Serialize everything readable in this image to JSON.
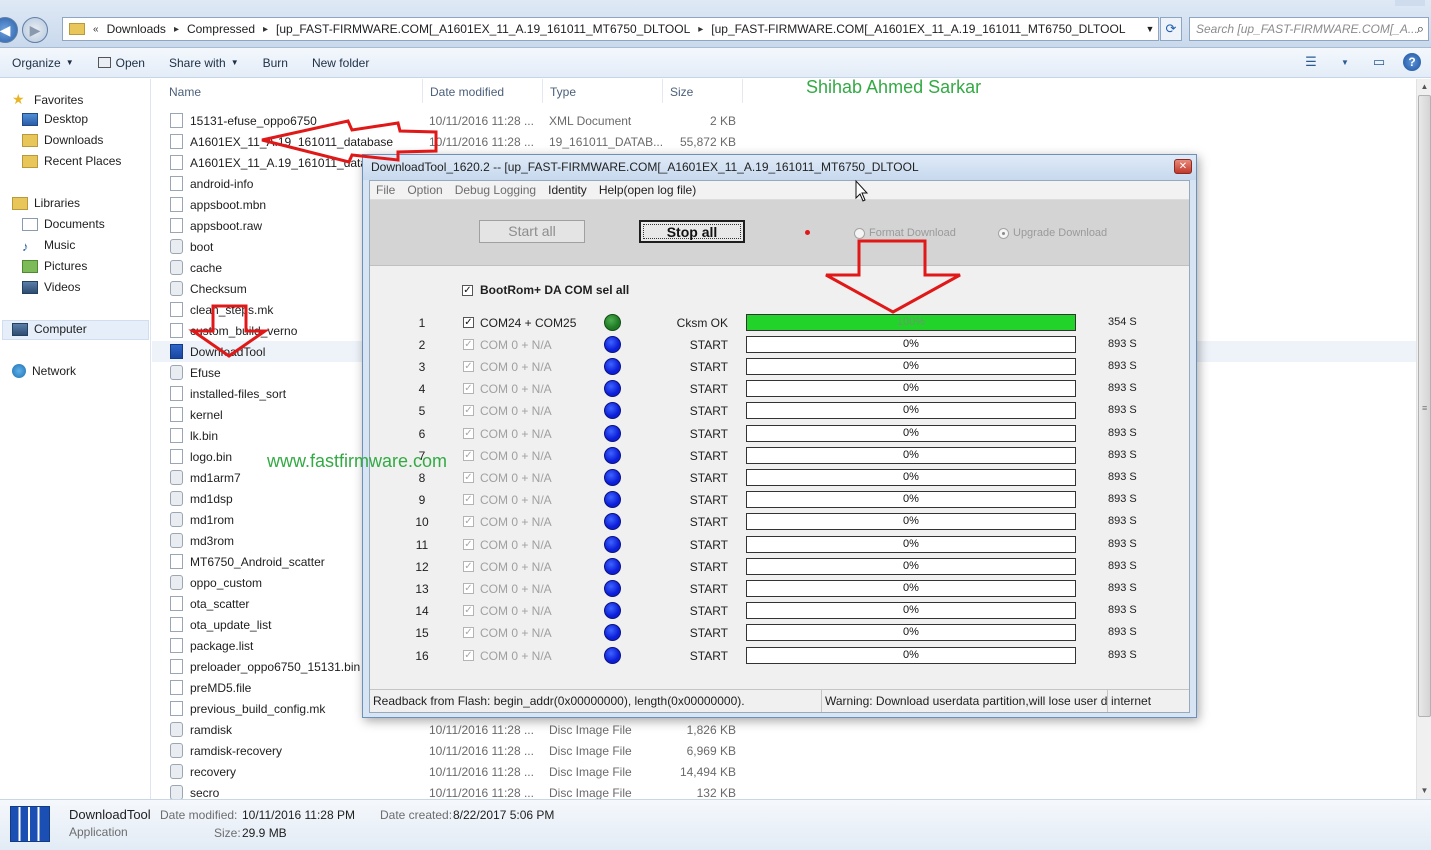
{
  "addressbar": {
    "crumbs": [
      "Downloads",
      "Compressed",
      "[up_FAST-FIRMWARE.COM[_A1601EX_11_A.19_161011_MT6750_DLTOOL",
      "[up_FAST-FIRMWARE.COM[_A1601EX_11_A.19_161011_MT6750_DLTOOL"
    ],
    "overflow": "«",
    "search_placeholder": "Search [up_FAST-FIRMWARE.COM[_A..."
  },
  "toolbar": {
    "organize": "Organize",
    "open": "Open",
    "share_with": "Share with",
    "burn": "Burn",
    "new_folder": "New folder"
  },
  "navpane": {
    "favorites": "Favorites",
    "desktop": "Desktop",
    "downloads": "Downloads",
    "recent_places": "Recent Places",
    "libraries": "Libraries",
    "documents": "Documents",
    "music": "Music",
    "pictures": "Pictures",
    "videos": "Videos",
    "computer": "Computer",
    "network": "Network"
  },
  "filelist": {
    "columns": {
      "name": "Name",
      "date": "Date modified",
      "type": "Type",
      "size": "Size"
    },
    "rows": [
      {
        "name": "15131-efuse_oppo6750",
        "date": "10/11/2016 11:28 ...",
        "type": "XML Document",
        "size": "2 KB",
        "icon": "xml"
      },
      {
        "name": "A1601EX_11_A.19_161011_database",
        "date": "10/11/2016 11:28 ...",
        "type": "19_161011_DATAB...",
        "size": "55,872 KB",
        "icon": "file"
      },
      {
        "name": "A1601EX_11_A.19_161011_database",
        "date": "",
        "type": "",
        "size": "",
        "icon": "file"
      },
      {
        "name": "android-info",
        "date": "",
        "type": "",
        "size": "",
        "icon": "file"
      },
      {
        "name": "appsboot.mbn",
        "date": "",
        "type": "",
        "size": "",
        "icon": "file"
      },
      {
        "name": "appsboot.raw",
        "date": "",
        "type": "",
        "size": "",
        "icon": "file"
      },
      {
        "name": "boot",
        "date": "",
        "type": "",
        "size": "",
        "icon": "disc"
      },
      {
        "name": "cache",
        "date": "",
        "type": "",
        "size": "",
        "icon": "disc"
      },
      {
        "name": "Checksum",
        "date": "",
        "type": "",
        "size": "",
        "icon": "gear"
      },
      {
        "name": "clean_steps.mk",
        "date": "",
        "type": "",
        "size": "",
        "icon": "file"
      },
      {
        "name": "custom_build_verno",
        "date": "",
        "type": "",
        "size": "",
        "icon": "file"
      },
      {
        "name": "DownloadTool",
        "date": "",
        "type": "",
        "size": "",
        "icon": "exe"
      },
      {
        "name": "Efuse",
        "date": "",
        "type": "",
        "size": "",
        "icon": "gear"
      },
      {
        "name": "installed-files_sort",
        "date": "",
        "type": "",
        "size": "",
        "icon": "file"
      },
      {
        "name": "kernel",
        "date": "",
        "type": "",
        "size": "",
        "icon": "file"
      },
      {
        "name": "lk.bin",
        "date": "",
        "type": "",
        "size": "",
        "icon": "file"
      },
      {
        "name": "logo.bin",
        "date": "",
        "type": "",
        "size": "",
        "icon": "file"
      },
      {
        "name": "md1arm7",
        "date": "",
        "type": "",
        "size": "",
        "icon": "disc"
      },
      {
        "name": "md1dsp",
        "date": "",
        "type": "",
        "size": "",
        "icon": "disc"
      },
      {
        "name": "md1rom",
        "date": "",
        "type": "",
        "size": "",
        "icon": "disc"
      },
      {
        "name": "md3rom",
        "date": "",
        "type": "",
        "size": "",
        "icon": "disc"
      },
      {
        "name": "MT6750_Android_scatter",
        "date": "",
        "type": "",
        "size": "",
        "icon": "file"
      },
      {
        "name": "oppo_custom",
        "date": "",
        "type": "",
        "size": "",
        "icon": "disc"
      },
      {
        "name": "ota_scatter",
        "date": "",
        "type": "",
        "size": "",
        "icon": "file"
      },
      {
        "name": "ota_update_list",
        "date": "",
        "type": "",
        "size": "",
        "icon": "file"
      },
      {
        "name": "package.list",
        "date": "",
        "type": "",
        "size": "",
        "icon": "file"
      },
      {
        "name": "preloader_oppo6750_15131.bin",
        "date": "",
        "type": "",
        "size": "",
        "icon": "file"
      },
      {
        "name": "preMD5.file",
        "date": "",
        "type": "",
        "size": "",
        "icon": "file"
      },
      {
        "name": "previous_build_config.mk",
        "date": "",
        "type": "",
        "size": "",
        "icon": "file"
      },
      {
        "name": "ramdisk",
        "date": "10/11/2016 11:28 ...",
        "type": "Disc Image File",
        "size": "1,826 KB",
        "icon": "disc"
      },
      {
        "name": "ramdisk-recovery",
        "date": "10/11/2016 11:28 ...",
        "type": "Disc Image File",
        "size": "6,969 KB",
        "icon": "disc"
      },
      {
        "name": "recovery",
        "date": "10/11/2016 11:28 ...",
        "type": "Disc Image File",
        "size": "14,494 KB",
        "icon": "disc"
      },
      {
        "name": "secro",
        "date": "10/11/2016 11:28 ...",
        "type": "Disc Image File",
        "size": "132 KB",
        "icon": "disc"
      }
    ]
  },
  "watermarks": {
    "author": "Shihab Ahmed Sarkar",
    "site": "www.fastfirmware.com"
  },
  "details": {
    "name": "DownloadTool",
    "type": "Application",
    "date_modified_label": "Date modified:",
    "date_modified": "10/11/2016 11:28 PM",
    "date_created_label": "Date created:",
    "date_created": "8/22/2017 5:06 PM",
    "size_label": "Size:",
    "size": "29.9 MB"
  },
  "dltool": {
    "title": "DownloadTool_1620.2 -- [up_FAST-FIRMWARE.COM[_A1601EX_11_A.19_161011_MT6750_DLTOOL",
    "menu": [
      "File",
      "Option",
      "Debug Logging",
      "Identity",
      "Help(open log file)"
    ],
    "start_all": "Start all",
    "stop_all": "Stop all",
    "format_download": "Format Download",
    "upgrade_download": "Upgrade Download",
    "select_all": "BootRom+ DA COM sel all",
    "ports": [
      {
        "idx": "1",
        "com": "COM24 + COM25",
        "status": "Cksm OK",
        "progress": 100,
        "pct": "100%",
        "time": "354 S"
      },
      {
        "idx": "2",
        "com": "COM 0 + N/A",
        "status": "START",
        "progress": 0,
        "pct": "0%",
        "time": "893 S"
      },
      {
        "idx": "3",
        "com": "COM 0 + N/A",
        "status": "START",
        "progress": 0,
        "pct": "0%",
        "time": "893 S"
      },
      {
        "idx": "4",
        "com": "COM 0 + N/A",
        "status": "START",
        "progress": 0,
        "pct": "0%",
        "time": "893 S"
      },
      {
        "idx": "5",
        "com": "COM 0 + N/A",
        "status": "START",
        "progress": 0,
        "pct": "0%",
        "time": "893 S"
      },
      {
        "idx": "6",
        "com": "COM 0 + N/A",
        "status": "START",
        "progress": 0,
        "pct": "0%",
        "time": "893 S"
      },
      {
        "idx": "7",
        "com": "COM 0 + N/A",
        "status": "START",
        "progress": 0,
        "pct": "0%",
        "time": "893 S"
      },
      {
        "idx": "8",
        "com": "COM 0 + N/A",
        "status": "START",
        "progress": 0,
        "pct": "0%",
        "time": "893 S"
      },
      {
        "idx": "9",
        "com": "COM 0 + N/A",
        "status": "START",
        "progress": 0,
        "pct": "0%",
        "time": "893 S"
      },
      {
        "idx": "10",
        "com": "COM 0 + N/A",
        "status": "START",
        "progress": 0,
        "pct": "0%",
        "time": "893 S"
      },
      {
        "idx": "11",
        "com": "COM 0 + N/A",
        "status": "START",
        "progress": 0,
        "pct": "0%",
        "time": "893 S"
      },
      {
        "idx": "12",
        "com": "COM 0 + N/A",
        "status": "START",
        "progress": 0,
        "pct": "0%",
        "time": "893 S"
      },
      {
        "idx": "13",
        "com": "COM 0 + N/A",
        "status": "START",
        "progress": 0,
        "pct": "0%",
        "time": "893 S"
      },
      {
        "idx": "14",
        "com": "COM 0 + N/A",
        "status": "START",
        "progress": 0,
        "pct": "0%",
        "time": "893 S"
      },
      {
        "idx": "15",
        "com": "COM 0 + N/A",
        "status": "START",
        "progress": 0,
        "pct": "0%",
        "time": "893 S"
      },
      {
        "idx": "16",
        "com": "COM 0 + N/A",
        "status": "START",
        "progress": 0,
        "pct": "0%",
        "time": "893 S"
      }
    ],
    "status_readback": "Readback from Flash:  begin_addr(0x00000000), length(0x00000000).",
    "status_warning": "Warning: Download userdata partition,will lose user d",
    "status_net": "internet"
  },
  "colors": {
    "watermark": "#33aa44",
    "progress_fill": "#22d32a",
    "led_idle": "#0c1ed8",
    "led_ok": "#1f7a24",
    "annotation_arrow": "#e01818"
  }
}
